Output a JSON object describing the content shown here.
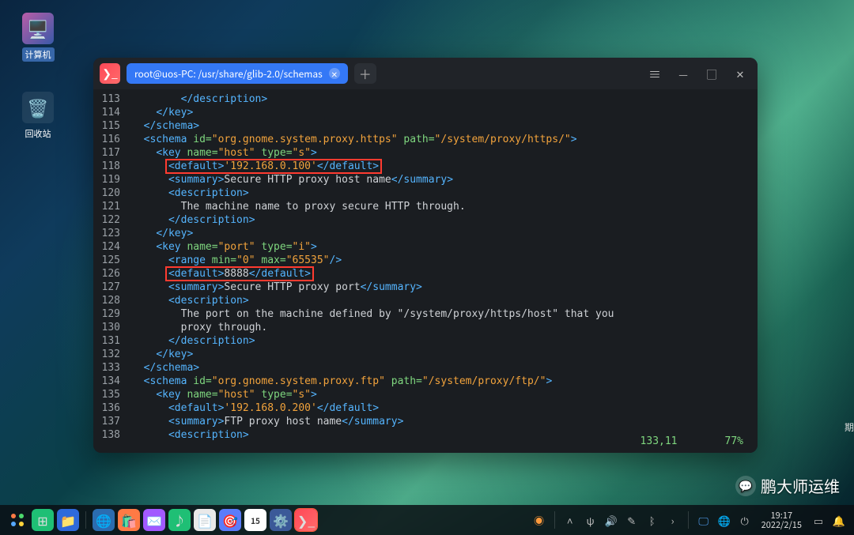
{
  "desktop": {
    "computer_label": "计算机",
    "trash_label": "回收站"
  },
  "terminal": {
    "tab_title": "root@uos-PC: /usr/share/glib-2.0/schemas",
    "status_pos": "133,11",
    "status_pct": "77%",
    "lines": [
      {
        "n": 113,
        "segs": [
          {
            "c": "txt",
            "t": "        "
          },
          {
            "c": "tag",
            "t": "</description>"
          }
        ]
      },
      {
        "n": 114,
        "segs": [
          {
            "c": "txt",
            "t": "    "
          },
          {
            "c": "tag",
            "t": "</key>"
          }
        ]
      },
      {
        "n": 115,
        "segs": [
          {
            "c": "txt",
            "t": "  "
          },
          {
            "c": "tag",
            "t": "</schema>"
          }
        ]
      },
      {
        "n": 116,
        "segs": [
          {
            "c": "txt",
            "t": "  "
          },
          {
            "c": "tag",
            "t": "<schema "
          },
          {
            "c": "attr",
            "t": "id="
          },
          {
            "c": "str",
            "t": "\"org.gnome.system.proxy.https\""
          },
          {
            "c": "attr",
            "t": " path="
          },
          {
            "c": "str",
            "t": "\"/system/proxy/https/\""
          },
          {
            "c": "tag",
            "t": ">"
          }
        ]
      },
      {
        "n": 117,
        "segs": [
          {
            "c": "txt",
            "t": "    "
          },
          {
            "c": "tag",
            "t": "<key "
          },
          {
            "c": "attr",
            "t": "name="
          },
          {
            "c": "str",
            "t": "\"host\""
          },
          {
            "c": "attr",
            "t": " type="
          },
          {
            "c": "str",
            "t": "\"s\""
          },
          {
            "c": "tag",
            "t": ">"
          }
        ]
      },
      {
        "n": 118,
        "hl": true,
        "segs": [
          {
            "c": "txt",
            "t": "      "
          },
          {
            "c": "tag",
            "t": "<default>"
          },
          {
            "c": "str",
            "t": "'192.168.0.100'"
          },
          {
            "c": "tag",
            "t": "</default>"
          }
        ]
      },
      {
        "n": 119,
        "segs": [
          {
            "c": "txt",
            "t": "      "
          },
          {
            "c": "tag",
            "t": "<summary>"
          },
          {
            "c": "txt",
            "t": "Secure HTTP proxy host name"
          },
          {
            "c": "tag",
            "t": "</summary>"
          }
        ]
      },
      {
        "n": 120,
        "segs": [
          {
            "c": "txt",
            "t": "      "
          },
          {
            "c": "tag",
            "t": "<description>"
          }
        ]
      },
      {
        "n": 121,
        "segs": [
          {
            "c": "txt",
            "t": "        "
          },
          {
            "c": "txt",
            "t": "The machine name to proxy secure HTTP through."
          }
        ]
      },
      {
        "n": 122,
        "segs": [
          {
            "c": "txt",
            "t": "      "
          },
          {
            "c": "tag",
            "t": "</description>"
          }
        ]
      },
      {
        "n": 123,
        "segs": [
          {
            "c": "txt",
            "t": "    "
          },
          {
            "c": "tag",
            "t": "</key>"
          }
        ]
      },
      {
        "n": 124,
        "segs": [
          {
            "c": "txt",
            "t": "    "
          },
          {
            "c": "tag",
            "t": "<key "
          },
          {
            "c": "attr",
            "t": "name="
          },
          {
            "c": "str",
            "t": "\"port\""
          },
          {
            "c": "attr",
            "t": " type="
          },
          {
            "c": "str",
            "t": "\"i\""
          },
          {
            "c": "tag",
            "t": ">"
          }
        ]
      },
      {
        "n": 125,
        "segs": [
          {
            "c": "txt",
            "t": "      "
          },
          {
            "c": "tag",
            "t": "<range "
          },
          {
            "c": "attr",
            "t": "min="
          },
          {
            "c": "str",
            "t": "\"0\""
          },
          {
            "c": "attr",
            "t": " max="
          },
          {
            "c": "str",
            "t": "\"65535\""
          },
          {
            "c": "tag",
            "t": "/>"
          }
        ]
      },
      {
        "n": 126,
        "hl": true,
        "segs": [
          {
            "c": "txt",
            "t": "      "
          },
          {
            "c": "tag",
            "t": "<default>"
          },
          {
            "c": "txt",
            "t": "8888"
          },
          {
            "c": "tag",
            "t": "</default>"
          }
        ]
      },
      {
        "n": 127,
        "segs": [
          {
            "c": "txt",
            "t": "      "
          },
          {
            "c": "tag",
            "t": "<summary>"
          },
          {
            "c": "txt",
            "t": "Secure HTTP proxy port"
          },
          {
            "c": "tag",
            "t": "</summary>"
          }
        ]
      },
      {
        "n": 128,
        "segs": [
          {
            "c": "txt",
            "t": "      "
          },
          {
            "c": "tag",
            "t": "<description>"
          }
        ]
      },
      {
        "n": 129,
        "segs": [
          {
            "c": "txt",
            "t": "        "
          },
          {
            "c": "txt",
            "t": "The port on the machine defined by \"/system/proxy/https/host\" that you"
          }
        ]
      },
      {
        "n": 130,
        "segs": [
          {
            "c": "txt",
            "t": "        "
          },
          {
            "c": "txt",
            "t": "proxy through."
          }
        ]
      },
      {
        "n": 131,
        "segs": [
          {
            "c": "txt",
            "t": "      "
          },
          {
            "c": "tag",
            "t": "</description>"
          }
        ]
      },
      {
        "n": 132,
        "segs": [
          {
            "c": "txt",
            "t": "    "
          },
          {
            "c": "tag",
            "t": "</key>"
          }
        ]
      },
      {
        "n": 133,
        "segs": [
          {
            "c": "txt",
            "t": "  "
          },
          {
            "c": "tag",
            "t": "</schema>"
          }
        ]
      },
      {
        "n": 134,
        "segs": [
          {
            "c": "txt",
            "t": "  "
          },
          {
            "c": "tag",
            "t": "<schema "
          },
          {
            "c": "attr",
            "t": "id="
          },
          {
            "c": "str",
            "t": "\"org.gnome.system.proxy.ftp\""
          },
          {
            "c": "attr",
            "t": " path="
          },
          {
            "c": "str",
            "t": "\"/system/proxy/ftp/\""
          },
          {
            "c": "tag",
            "t": ">"
          }
        ]
      },
      {
        "n": 135,
        "segs": [
          {
            "c": "txt",
            "t": "    "
          },
          {
            "c": "tag",
            "t": "<key "
          },
          {
            "c": "attr",
            "t": "name="
          },
          {
            "c": "str",
            "t": "\"host\""
          },
          {
            "c": "attr",
            "t": " type="
          },
          {
            "c": "str",
            "t": "\"s\""
          },
          {
            "c": "tag",
            "t": ">"
          }
        ]
      },
      {
        "n": 136,
        "segs": [
          {
            "c": "txt",
            "t": "      "
          },
          {
            "c": "tag",
            "t": "<default>"
          },
          {
            "c": "str",
            "t": "'192.168.0.200'"
          },
          {
            "c": "tag",
            "t": "</default>"
          }
        ]
      },
      {
        "n": 137,
        "segs": [
          {
            "c": "txt",
            "t": "      "
          },
          {
            "c": "tag",
            "t": "<summary>"
          },
          {
            "c": "txt",
            "t": "FTP proxy host name"
          },
          {
            "c": "tag",
            "t": "</summary>"
          }
        ]
      },
      {
        "n": 138,
        "segs": [
          {
            "c": "txt",
            "t": "      "
          },
          {
            "c": "tag",
            "t": "<description>"
          }
        ]
      }
    ]
  },
  "taskbar": {
    "apps": [
      "launcher",
      "multitask",
      "files",
      "browser",
      "app-store",
      "mail",
      "music",
      "text",
      "screenshot",
      "calendar",
      "settings",
      "terminal"
    ],
    "tray": [
      "uget",
      "chevron-up",
      "usb",
      "volume",
      "writing",
      "bluetooth",
      "chevron-right",
      "separator",
      "display",
      "network",
      "power"
    ],
    "clock_time": "19:17",
    "clock_date": "2022/2/15"
  },
  "watermark": "鹏大师运维",
  "edge_text": "期"
}
